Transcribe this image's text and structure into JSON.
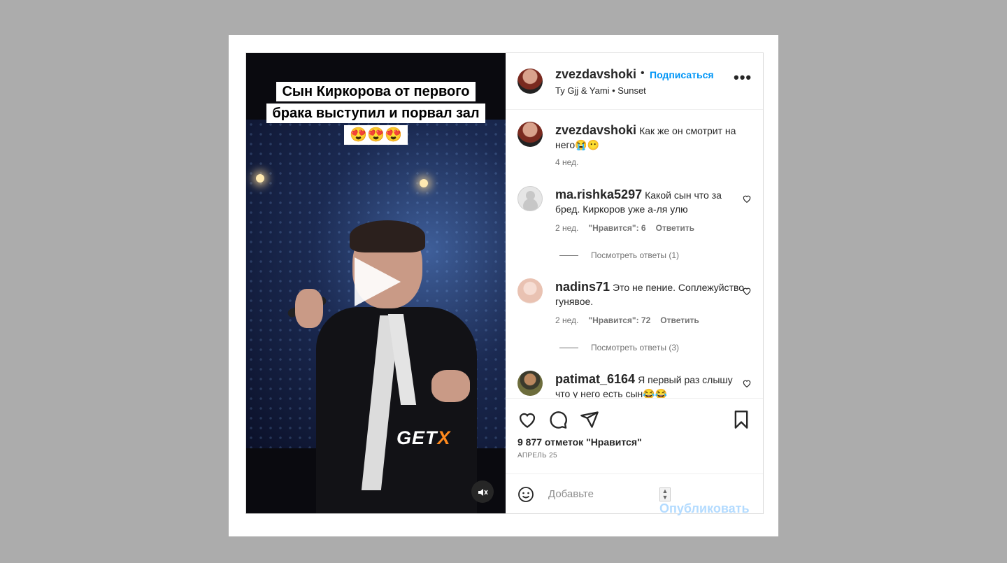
{
  "video": {
    "caption": "Сын Киркорова от первого брака выступил и порвал зал😍😍😍",
    "watermark_a": "GET",
    "watermark_b": "X"
  },
  "header": {
    "username": "zvezdavshoki",
    "separator": "•",
    "follow_label": "Подписаться",
    "music": "Ty Gjj & Yami • Sunset",
    "more": "•••"
  },
  "comments": [
    {
      "user": "zvezdavshoki",
      "text": "Как же он смотрит на него😭😶",
      "time": "4 нед."
    },
    {
      "user": "ma.rishka5297",
      "text": "Какой сын что за бред. Киркоров уже а-ля улю",
      "time": "2 нед.",
      "likes": "\"Нравится\": 6",
      "reply": "Ответить",
      "view_replies": "Посмотреть ответы (1)"
    },
    {
      "user": "nadins71",
      "text": "Это не пение. Соплежуйство гунявое.",
      "time": "2 нед.",
      "likes": "\"Нравится\": 72",
      "reply": "Ответить",
      "view_replies": "Посмотреть ответы (3)"
    },
    {
      "user": "patimat_6164",
      "text": "Я первый раз слышу что у него есть сын😂😂"
    }
  ],
  "actions": {
    "likes": "9 877 отметок \"Нравится\"",
    "date": "АПРЕЛЬ 25"
  },
  "add_comment": {
    "placeholder": "Добавьте",
    "publish_label": "Опубликовать"
  },
  "colors": {
    "accent": "#0095f6",
    "publish_disabled": "#b3dbff",
    "watermark_x": "#ff8a1e"
  }
}
